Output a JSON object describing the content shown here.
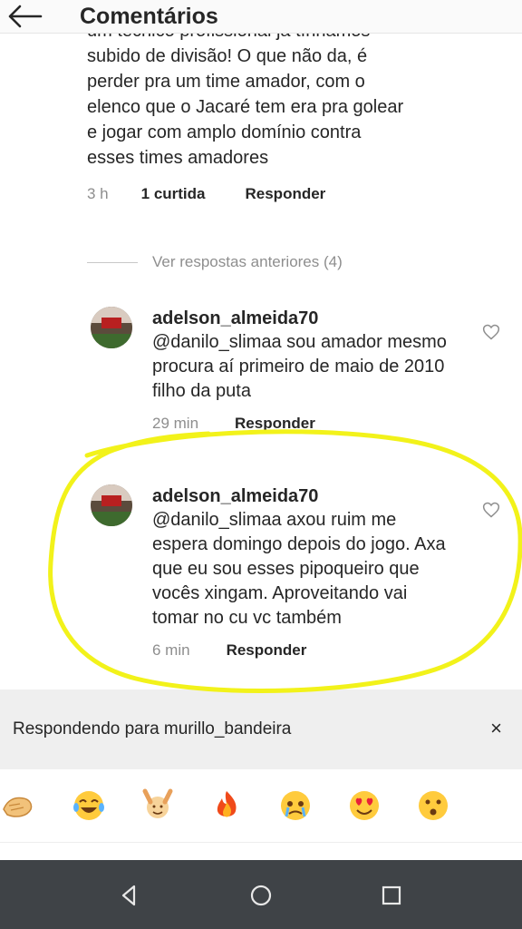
{
  "header": {
    "title": "Comentários",
    "back_icon": "arrow-left-icon"
  },
  "top_comment": {
    "cut_text": "um técnico profissional já tínhamos",
    "text": "subido de divisão! O que não da, é\nperder pra um time amador, com o\nelenco que o Jacaré tem era pra golear\ne jogar com amplo domínio contra\nesses times amadores",
    "time": "3 h",
    "likes": "1 curtida",
    "reply_label": "Responder"
  },
  "previous_replies": {
    "label": "Ver respostas anteriores (4)"
  },
  "replies": [
    {
      "username": "adelson_almeida70",
      "text": "@danilo_slimaa sou amador mesmo procura aí primeiro de maio de 2010 filho da puta",
      "time": "29 min",
      "reply_label": "Responder"
    },
    {
      "username": "adelson_almeida70",
      "text": "@danilo_slimaa axou ruim me espera domingo depois do jogo. Axa que eu sou esses pipoqueiro que vocês xingam. Aproveitando vai tomar no cu vc também",
      "time": "6 min",
      "reply_label": "Responder"
    }
  ],
  "replying_bar": {
    "label": "Respondendo para murillo_bandeira",
    "close": "×"
  },
  "emojis": [
    "clapping-hands-icon",
    "tears-of-joy-icon",
    "raising-hands-icon",
    "fire-icon",
    "crying-face-icon",
    "heart-eyes-icon",
    "surprised-face-icon"
  ],
  "navbar": {
    "buttons": [
      "back-triangle-icon",
      "home-circle-icon",
      "recents-square-icon"
    ]
  },
  "colors": {
    "highlight": "#f2f21a",
    "text": "#262626",
    "muted": "#8e8e8e",
    "navbar": "#3f4347"
  }
}
